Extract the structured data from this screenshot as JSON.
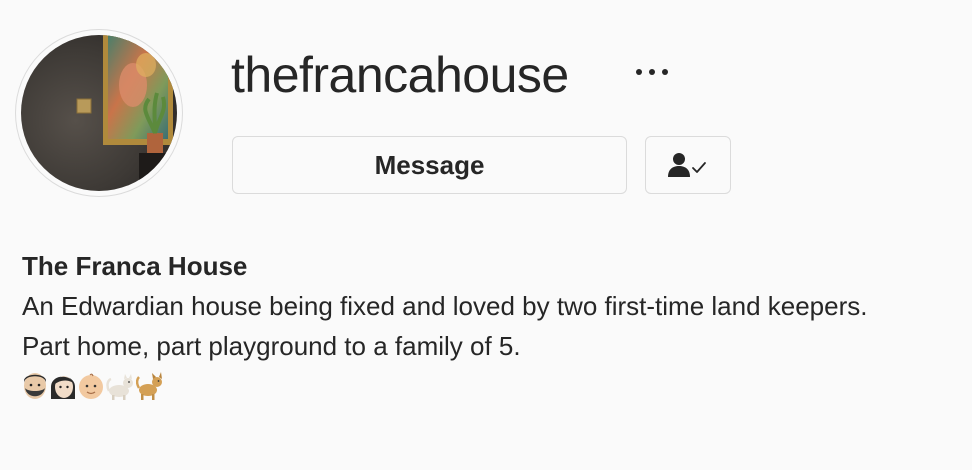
{
  "profile": {
    "username": "thefrancahouse",
    "more_icon": "ellipsis-icon",
    "avatar_alt": "avatar",
    "buttons": {
      "message_label": "Message",
      "following_icon": "person-check-icon"
    },
    "bio": {
      "name": "The Franca House",
      "line1": "An Edwardian house being fixed and loved by two first-time land keepers.",
      "line2": "Part home, part playground to a family of 5.",
      "emojis": [
        "man-beard-emoji",
        "woman-emoji",
        "baby-emoji",
        "cat-emoji",
        "dog-emoji"
      ]
    }
  },
  "colors": {
    "background": "#fafafa",
    "text": "#262626",
    "border": "#dbdbdb"
  }
}
